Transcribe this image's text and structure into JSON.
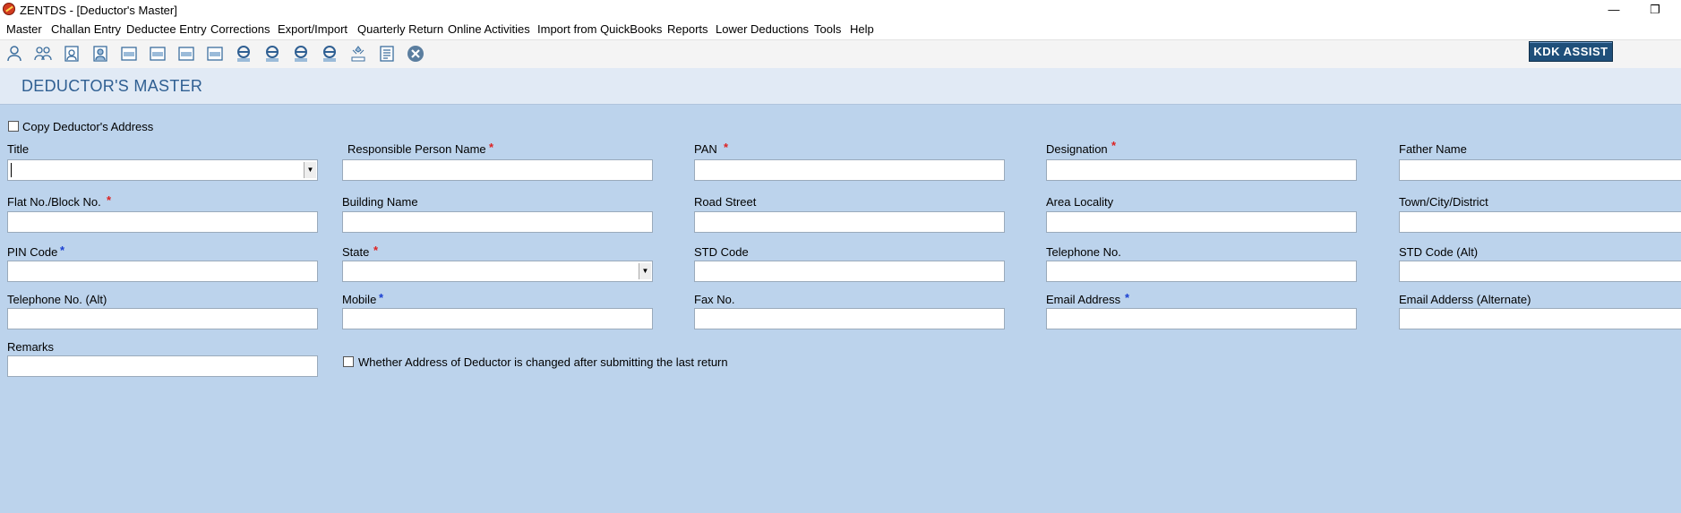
{
  "window": {
    "title": "ZENTDS - [Deductor's Master]",
    "minimize_glyph": "—",
    "restore_glyph": "❐"
  },
  "menu": [
    "Master",
    "Challan Entry",
    "Deductee Entry",
    "Corrections",
    "Export/Import",
    "Quarterly Return",
    "Online Activities",
    "Import from QuickBooks",
    "Reports",
    "Lower Deductions",
    "Tools",
    "Help"
  ],
  "toolbar": {
    "icons": [
      "deductor-icon",
      "deductees-icon",
      "deductor-master-icon",
      "deductee-master-icon",
      "form-24q-icon",
      "form-26q-icon",
      "form-27q-icon",
      "form-27eq-icon",
      "e-24q-icon",
      "e-26q-icon",
      "e-27q-icon",
      "e-27eq-icon",
      "tds-icon",
      "report-icon",
      "close-icon"
    ],
    "kdk_assist_label": "KDK ASSIST"
  },
  "page": {
    "title": "DEDUCTOR'S MASTER"
  },
  "form": {
    "copy_address_label": "Copy Deductor's Address",
    "required_mark": "*",
    "fields": {
      "title": {
        "label": "Title",
        "value": ""
      },
      "responsible_person_name": {
        "label": "Responsible Person Name",
        "value": ""
      },
      "pan": {
        "label": "PAN",
        "value": ""
      },
      "designation": {
        "label": "Designation",
        "value": ""
      },
      "father_name": {
        "label": "Father Name",
        "value": ""
      },
      "flat_no": {
        "label": "Flat No./Block No.",
        "value": ""
      },
      "building_name": {
        "label": "Building Name",
        "value": ""
      },
      "road_street": {
        "label": "Road Street",
        "value": ""
      },
      "area_locality": {
        "label": "Area Locality",
        "value": ""
      },
      "town_city": {
        "label": "Town/City/District",
        "value": ""
      },
      "pin_code": {
        "label": "PIN Code",
        "value": ""
      },
      "state": {
        "label": "State",
        "value": ""
      },
      "std_code": {
        "label": "STD Code",
        "value": ""
      },
      "telephone": {
        "label": "Telephone No.",
        "value": ""
      },
      "std_code_alt": {
        "label": "STD Code (Alt)",
        "value": ""
      },
      "telephone_alt": {
        "label": "Telephone No. (Alt)",
        "value": ""
      },
      "mobile": {
        "label": "Mobile",
        "value": ""
      },
      "fax": {
        "label": "Fax No.",
        "value": ""
      },
      "email": {
        "label": "Email Address",
        "value": ""
      },
      "email_alt": {
        "label": "Email Adderss (Alternate)",
        "value": ""
      },
      "remarks": {
        "label": "Remarks",
        "value": ""
      }
    },
    "address_changed_label": "Whether Address of Deductor is changed after submitting the last return"
  },
  "colors": {
    "background": "#bcd3ec",
    "header_band": "#e1eaf5",
    "title_text": "#2f5f92",
    "required_red": "#dd2222",
    "required_blue": "#1a3fd1",
    "kdk_button": "#1f4f7a"
  }
}
